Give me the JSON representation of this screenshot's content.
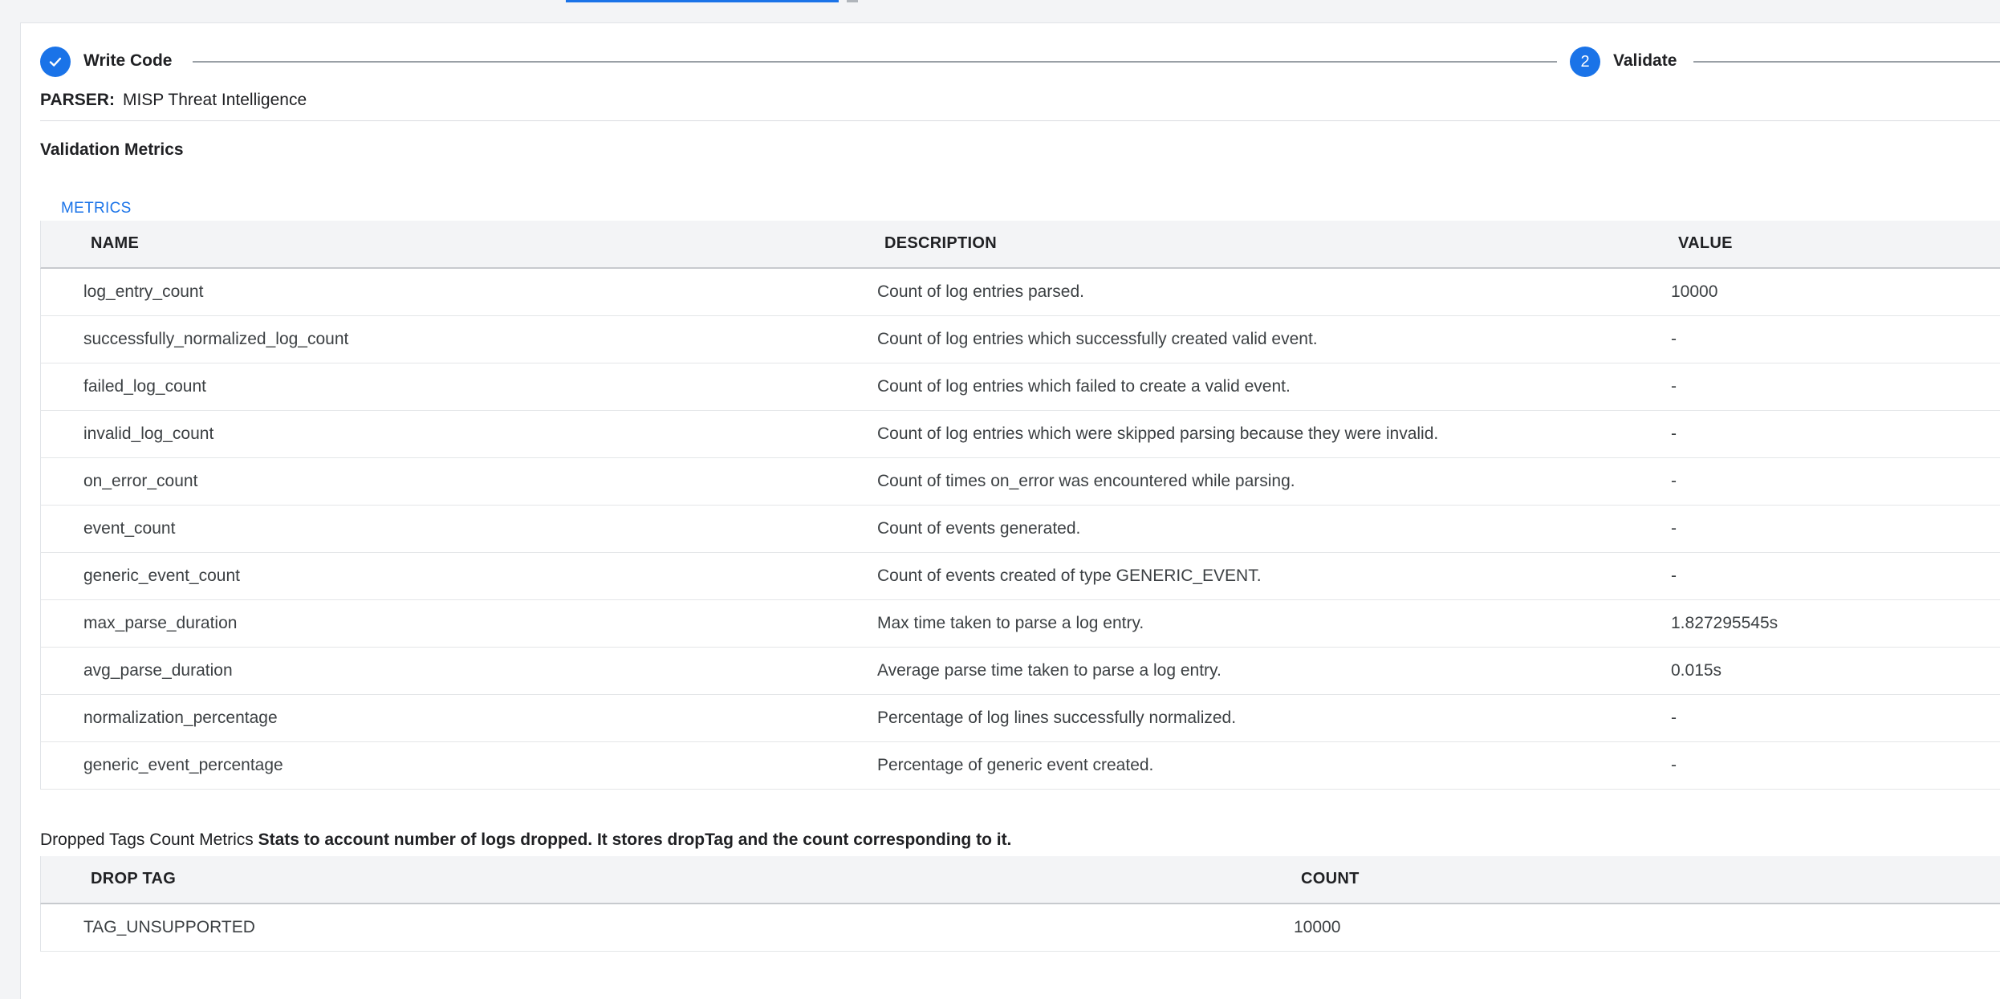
{
  "stepper": {
    "steps": [
      {
        "label": "Write Code",
        "state": "complete",
        "icon": "check-icon"
      },
      {
        "label": "Validate",
        "state": "active",
        "number": "2"
      }
    ]
  },
  "parser": {
    "label": "PARSER:",
    "value": "MISP Threat Intelligence"
  },
  "validation": {
    "title": "Validation Metrics",
    "tab": "METRICS",
    "headers": {
      "name": "NAME",
      "description": "DESCRIPTION",
      "value": "VALUE"
    },
    "rows": [
      {
        "name": "log_entry_count",
        "description": "Count of log entries parsed.",
        "value": "10000"
      },
      {
        "name": "successfully_normalized_log_count",
        "description": "Count of log entries which successfully created valid event.",
        "value": "-"
      },
      {
        "name": "failed_log_count",
        "description": "Count of log entries which failed to create a valid event.",
        "value": "-"
      },
      {
        "name": "invalid_log_count",
        "description": "Count of log entries which were skipped parsing because they were invalid.",
        "value": "-"
      },
      {
        "name": "on_error_count",
        "description": "Count of times on_error was encountered while parsing.",
        "value": "-"
      },
      {
        "name": "event_count",
        "description": "Count of events generated.",
        "value": "-"
      },
      {
        "name": "generic_event_count",
        "description": "Count of events created of type GENERIC_EVENT.",
        "value": "-"
      },
      {
        "name": "max_parse_duration",
        "description": "Max time taken to parse a log entry.",
        "value": "1.827295545s"
      },
      {
        "name": "avg_parse_duration",
        "description": "Average parse time taken to parse a log entry.",
        "value": "0.015s"
      },
      {
        "name": "normalization_percentage",
        "description": "Percentage of log lines successfully normalized.",
        "value": "-"
      },
      {
        "name": "generic_event_percentage",
        "description": "Percentage of generic event created.",
        "value": "-"
      }
    ]
  },
  "dropped": {
    "label": "Dropped Tags Count Metrics",
    "description": "Stats to account number of logs dropped. It stores dropTag and the count corresponding to it.",
    "headers": {
      "tag": "DROP TAG",
      "count": "COUNT"
    },
    "rows": [
      {
        "tag": "TAG_UNSUPPORTED",
        "count": "10000"
      }
    ]
  },
  "colors": {
    "accent": "#1a73e8",
    "header_bg": "#f3f4f6"
  }
}
